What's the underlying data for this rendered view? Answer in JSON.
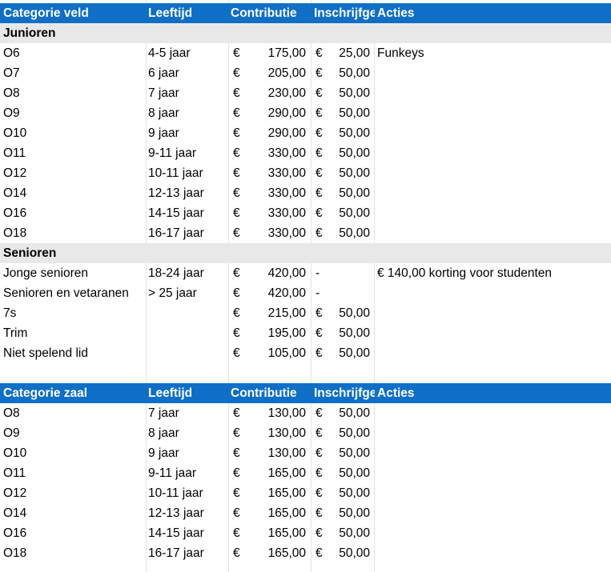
{
  "veld": {
    "headers": {
      "cat": "Categorie veld",
      "age": "Leeftijd",
      "contrib": "Contributie",
      "inschr": "Inschrijfgeld",
      "acties": "Acties"
    },
    "groups": [
      {
        "title": "Junioren",
        "rows": [
          {
            "cat": "O6",
            "age": "4-5 jaar",
            "contrib": "175,00",
            "inschr": "25,00",
            "acties": "Funkeys"
          },
          {
            "cat": "O7",
            "age": "6 jaar",
            "contrib": "205,00",
            "inschr": "50,00",
            "acties": ""
          },
          {
            "cat": "O8",
            "age": "7 jaar",
            "contrib": "230,00",
            "inschr": "50,00",
            "acties": ""
          },
          {
            "cat": "O9",
            "age": "8 jaar",
            "contrib": "290,00",
            "inschr": "50,00",
            "acties": ""
          },
          {
            "cat": "O10",
            "age": "9 jaar",
            "contrib": "290,00",
            "inschr": "50,00",
            "acties": ""
          },
          {
            "cat": "O11",
            "age": "9-11 jaar",
            "contrib": "330,00",
            "inschr": "50,00",
            "acties": ""
          },
          {
            "cat": "O12",
            "age": "10-11 jaar",
            "contrib": "330,00",
            "inschr": "50,00",
            "acties": ""
          },
          {
            "cat": "O14",
            "age": "12-13 jaar",
            "contrib": "330,00",
            "inschr": "50,00",
            "acties": ""
          },
          {
            "cat": "O16",
            "age": "14-15 jaar",
            "contrib": "330,00",
            "inschr": "50,00",
            "acties": ""
          },
          {
            "cat": "O18",
            "age": "16-17 jaar",
            "contrib": "330,00",
            "inschr": "50,00",
            "acties": ""
          }
        ]
      },
      {
        "title": "Senioren",
        "rows": [
          {
            "cat": "Jonge senioren",
            "age": "18-24 jaar",
            "contrib": "420,00",
            "inschr": "-",
            "acties": "€ 140,00 korting voor studenten"
          },
          {
            "cat": "Senioren en vetaranen",
            "age": "> 25 jaar",
            "contrib": "420,00",
            "inschr": "-",
            "acties": ""
          },
          {
            "cat": "7s",
            "age": "",
            "contrib": "215,00",
            "inschr": "50,00",
            "acties": ""
          },
          {
            "cat": "Trim",
            "age": "",
            "contrib": "195,00",
            "inschr": "50,00",
            "acties": ""
          },
          {
            "cat": "Niet spelend lid",
            "age": "",
            "contrib": "105,00",
            "inschr": "50,00",
            "acties": ""
          }
        ]
      }
    ]
  },
  "zaal": {
    "headers": {
      "cat": "Categorie zaal",
      "age": "Leeftijd",
      "contrib": "Contributie",
      "inschr": "Inschrijfgeld",
      "acties": "Acties"
    },
    "rows": [
      {
        "cat": "O8",
        "age": "7 jaar",
        "contrib": "130,00",
        "inschr": "50,00",
        "acties": ""
      },
      {
        "cat": "O9",
        "age": "8 jaar",
        "contrib": "130,00",
        "inschr": "50,00",
        "acties": ""
      },
      {
        "cat": "O10",
        "age": "9 jaar",
        "contrib": "130,00",
        "inschr": "50,00",
        "acties": ""
      },
      {
        "cat": "O11",
        "age": "9-11 jaar",
        "contrib": "165,00",
        "inschr": "50,00",
        "acties": ""
      },
      {
        "cat": "O12",
        "age": "10-11 jaar",
        "contrib": "165,00",
        "inschr": "50,00",
        "acties": ""
      },
      {
        "cat": "O14",
        "age": "12-13 jaar",
        "contrib": "165,00",
        "inschr": "50,00",
        "acties": ""
      },
      {
        "cat": "O16",
        "age": "14-15 jaar",
        "contrib": "165,00",
        "inschr": "50,00",
        "acties": ""
      },
      {
        "cat": "O18",
        "age": "16-17 jaar",
        "contrib": "165,00",
        "inschr": "50,00",
        "acties": ""
      }
    ]
  },
  "currency_symbol": "€",
  "colors": {
    "header_bg": "#0f6fc6",
    "header_text": "#ffffff",
    "group_bg": "#e8e8e8"
  }
}
